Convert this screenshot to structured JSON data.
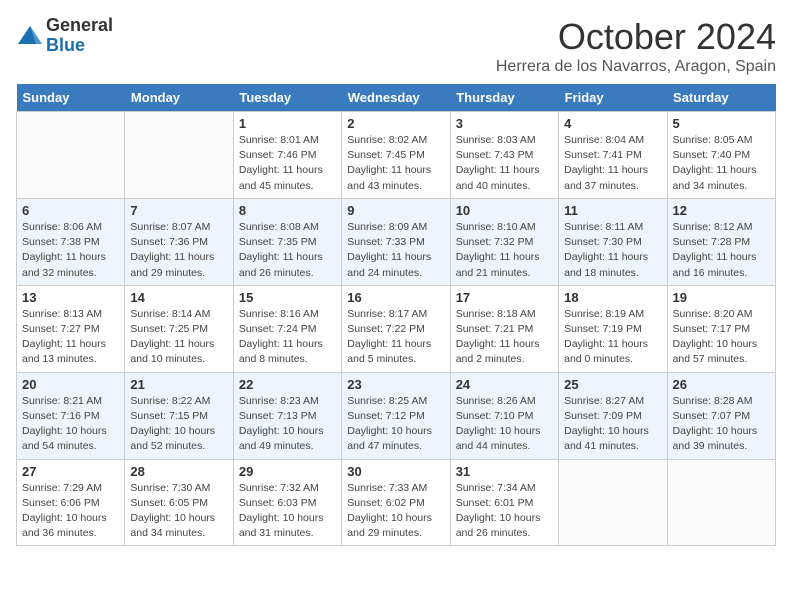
{
  "header": {
    "logo_general": "General",
    "logo_blue": "Blue",
    "month": "October 2024",
    "location": "Herrera de los Navarros, Aragon, Spain"
  },
  "days_of_week": [
    "Sunday",
    "Monday",
    "Tuesday",
    "Wednesday",
    "Thursday",
    "Friday",
    "Saturday"
  ],
  "weeks": [
    [
      {
        "day": "",
        "sunrise": "",
        "sunset": "",
        "daylight": ""
      },
      {
        "day": "",
        "sunrise": "",
        "sunset": "",
        "daylight": ""
      },
      {
        "day": "1",
        "sunrise": "Sunrise: 8:01 AM",
        "sunset": "Sunset: 7:46 PM",
        "daylight": "Daylight: 11 hours and 45 minutes."
      },
      {
        "day": "2",
        "sunrise": "Sunrise: 8:02 AM",
        "sunset": "Sunset: 7:45 PM",
        "daylight": "Daylight: 11 hours and 43 minutes."
      },
      {
        "day": "3",
        "sunrise": "Sunrise: 8:03 AM",
        "sunset": "Sunset: 7:43 PM",
        "daylight": "Daylight: 11 hours and 40 minutes."
      },
      {
        "day": "4",
        "sunrise": "Sunrise: 8:04 AM",
        "sunset": "Sunset: 7:41 PM",
        "daylight": "Daylight: 11 hours and 37 minutes."
      },
      {
        "day": "5",
        "sunrise": "Sunrise: 8:05 AM",
        "sunset": "Sunset: 7:40 PM",
        "daylight": "Daylight: 11 hours and 34 minutes."
      }
    ],
    [
      {
        "day": "6",
        "sunrise": "Sunrise: 8:06 AM",
        "sunset": "Sunset: 7:38 PM",
        "daylight": "Daylight: 11 hours and 32 minutes."
      },
      {
        "day": "7",
        "sunrise": "Sunrise: 8:07 AM",
        "sunset": "Sunset: 7:36 PM",
        "daylight": "Daylight: 11 hours and 29 minutes."
      },
      {
        "day": "8",
        "sunrise": "Sunrise: 8:08 AM",
        "sunset": "Sunset: 7:35 PM",
        "daylight": "Daylight: 11 hours and 26 minutes."
      },
      {
        "day": "9",
        "sunrise": "Sunrise: 8:09 AM",
        "sunset": "Sunset: 7:33 PM",
        "daylight": "Daylight: 11 hours and 24 minutes."
      },
      {
        "day": "10",
        "sunrise": "Sunrise: 8:10 AM",
        "sunset": "Sunset: 7:32 PM",
        "daylight": "Daylight: 11 hours and 21 minutes."
      },
      {
        "day": "11",
        "sunrise": "Sunrise: 8:11 AM",
        "sunset": "Sunset: 7:30 PM",
        "daylight": "Daylight: 11 hours and 18 minutes."
      },
      {
        "day": "12",
        "sunrise": "Sunrise: 8:12 AM",
        "sunset": "Sunset: 7:28 PM",
        "daylight": "Daylight: 11 hours and 16 minutes."
      }
    ],
    [
      {
        "day": "13",
        "sunrise": "Sunrise: 8:13 AM",
        "sunset": "Sunset: 7:27 PM",
        "daylight": "Daylight: 11 hours and 13 minutes."
      },
      {
        "day": "14",
        "sunrise": "Sunrise: 8:14 AM",
        "sunset": "Sunset: 7:25 PM",
        "daylight": "Daylight: 11 hours and 10 minutes."
      },
      {
        "day": "15",
        "sunrise": "Sunrise: 8:16 AM",
        "sunset": "Sunset: 7:24 PM",
        "daylight": "Daylight: 11 hours and 8 minutes."
      },
      {
        "day": "16",
        "sunrise": "Sunrise: 8:17 AM",
        "sunset": "Sunset: 7:22 PM",
        "daylight": "Daylight: 11 hours and 5 minutes."
      },
      {
        "day": "17",
        "sunrise": "Sunrise: 8:18 AM",
        "sunset": "Sunset: 7:21 PM",
        "daylight": "Daylight: 11 hours and 2 minutes."
      },
      {
        "day": "18",
        "sunrise": "Sunrise: 8:19 AM",
        "sunset": "Sunset: 7:19 PM",
        "daylight": "Daylight: 11 hours and 0 minutes."
      },
      {
        "day": "19",
        "sunrise": "Sunrise: 8:20 AM",
        "sunset": "Sunset: 7:17 PM",
        "daylight": "Daylight: 10 hours and 57 minutes."
      }
    ],
    [
      {
        "day": "20",
        "sunrise": "Sunrise: 8:21 AM",
        "sunset": "Sunset: 7:16 PM",
        "daylight": "Daylight: 10 hours and 54 minutes."
      },
      {
        "day": "21",
        "sunrise": "Sunrise: 8:22 AM",
        "sunset": "Sunset: 7:15 PM",
        "daylight": "Daylight: 10 hours and 52 minutes."
      },
      {
        "day": "22",
        "sunrise": "Sunrise: 8:23 AM",
        "sunset": "Sunset: 7:13 PM",
        "daylight": "Daylight: 10 hours and 49 minutes."
      },
      {
        "day": "23",
        "sunrise": "Sunrise: 8:25 AM",
        "sunset": "Sunset: 7:12 PM",
        "daylight": "Daylight: 10 hours and 47 minutes."
      },
      {
        "day": "24",
        "sunrise": "Sunrise: 8:26 AM",
        "sunset": "Sunset: 7:10 PM",
        "daylight": "Daylight: 10 hours and 44 minutes."
      },
      {
        "day": "25",
        "sunrise": "Sunrise: 8:27 AM",
        "sunset": "Sunset: 7:09 PM",
        "daylight": "Daylight: 10 hours and 41 minutes."
      },
      {
        "day": "26",
        "sunrise": "Sunrise: 8:28 AM",
        "sunset": "Sunset: 7:07 PM",
        "daylight": "Daylight: 10 hours and 39 minutes."
      }
    ],
    [
      {
        "day": "27",
        "sunrise": "Sunrise: 7:29 AM",
        "sunset": "Sunset: 6:06 PM",
        "daylight": "Daylight: 10 hours and 36 minutes."
      },
      {
        "day": "28",
        "sunrise": "Sunrise: 7:30 AM",
        "sunset": "Sunset: 6:05 PM",
        "daylight": "Daylight: 10 hours and 34 minutes."
      },
      {
        "day": "29",
        "sunrise": "Sunrise: 7:32 AM",
        "sunset": "Sunset: 6:03 PM",
        "daylight": "Daylight: 10 hours and 31 minutes."
      },
      {
        "day": "30",
        "sunrise": "Sunrise: 7:33 AM",
        "sunset": "Sunset: 6:02 PM",
        "daylight": "Daylight: 10 hours and 29 minutes."
      },
      {
        "day": "31",
        "sunrise": "Sunrise: 7:34 AM",
        "sunset": "Sunset: 6:01 PM",
        "daylight": "Daylight: 10 hours and 26 minutes."
      },
      {
        "day": "",
        "sunrise": "",
        "sunset": "",
        "daylight": ""
      },
      {
        "day": "",
        "sunrise": "",
        "sunset": "",
        "daylight": ""
      }
    ]
  ]
}
